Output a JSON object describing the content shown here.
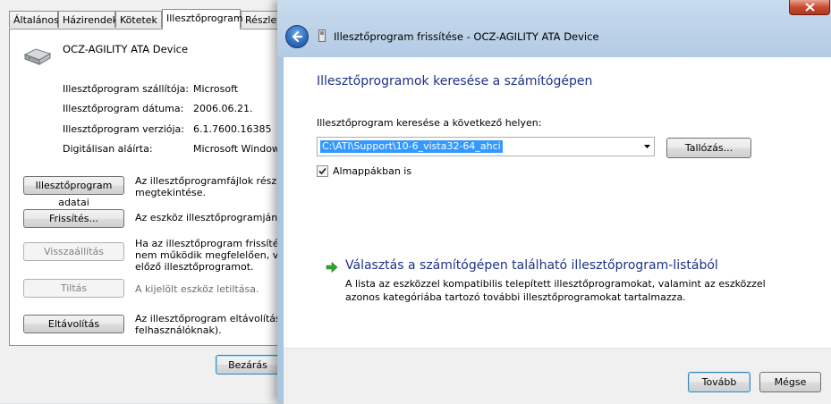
{
  "properties": {
    "tabs": [
      {
        "label": "Általános"
      },
      {
        "label": "Házirendek"
      },
      {
        "label": "Kötetek"
      },
      {
        "label": "Illesztőprogram"
      },
      {
        "label": "Részlete"
      }
    ],
    "device_name": "OCZ-AGILITY ATA Device",
    "rows": [
      {
        "label": "Illesztőprogram szállítója:",
        "value": "Microsoft"
      },
      {
        "label": "Illesztőprogram dátuma:",
        "value": "2006.06.21."
      },
      {
        "label": "Illesztőprogram verziója:",
        "value": "6.1.7600.16385"
      },
      {
        "label": "Digitálisan aláírta:",
        "value": "Microsoft Windows"
      }
    ],
    "buttons": [
      {
        "label": "Illesztőprogram adatai",
        "desc1": "Az illesztőprogramfájlok részleteine",
        "desc2": "megtekintése."
      },
      {
        "label": "Frissítés...",
        "desc1": "Az eszköz illesztőprogramjának fris",
        "desc2": ""
      },
      {
        "label": "Visszaállítás",
        "desc1": "Ha az illesztőprogram frissítése ut",
        "desc2": "nem működik megfelelően, vissza",
        "desc3": "előző illesztőprogramot."
      },
      {
        "label": "Tiltás",
        "desc1": "A kijelölt eszköz letiltása.",
        "desc2": ""
      },
      {
        "label": "Eltávolítás",
        "desc1": "Az illesztőprogram eltávolítása (ha",
        "desc2": "felhasználóknak)."
      }
    ],
    "close_label": "Bezárás"
  },
  "wizard": {
    "title": "Illesztőprogram frissítése - OCZ-AGILITY ATA Device",
    "heading": "Illesztőprogramok keresése a számítógépen",
    "search_label": "Illesztőprogram keresése a következő helyen:",
    "path_value": "C:\\ATI\\Support\\10-6_vista32-64_ahci",
    "browse_label": "Tallózás...",
    "subfolders_label": "Almappákban is",
    "subfolders_checked": true,
    "choose_link": "Választás a számítógépen található illesztőprogram-listából",
    "choose_desc_line1": "A lista az eszközzel kompatibilis telepített illesztőprogramokat, valamint az eszközzel",
    "choose_desc_line2": "azonos kategóriába tartozó további illesztőprogramokat tartalmazza.",
    "next_label": "Tovább",
    "cancel_label": "Mégse"
  },
  "colors": {
    "heading_blue": "#1e3287",
    "selection_blue": "#3399ff",
    "arrow_green": "#2ea82e"
  }
}
